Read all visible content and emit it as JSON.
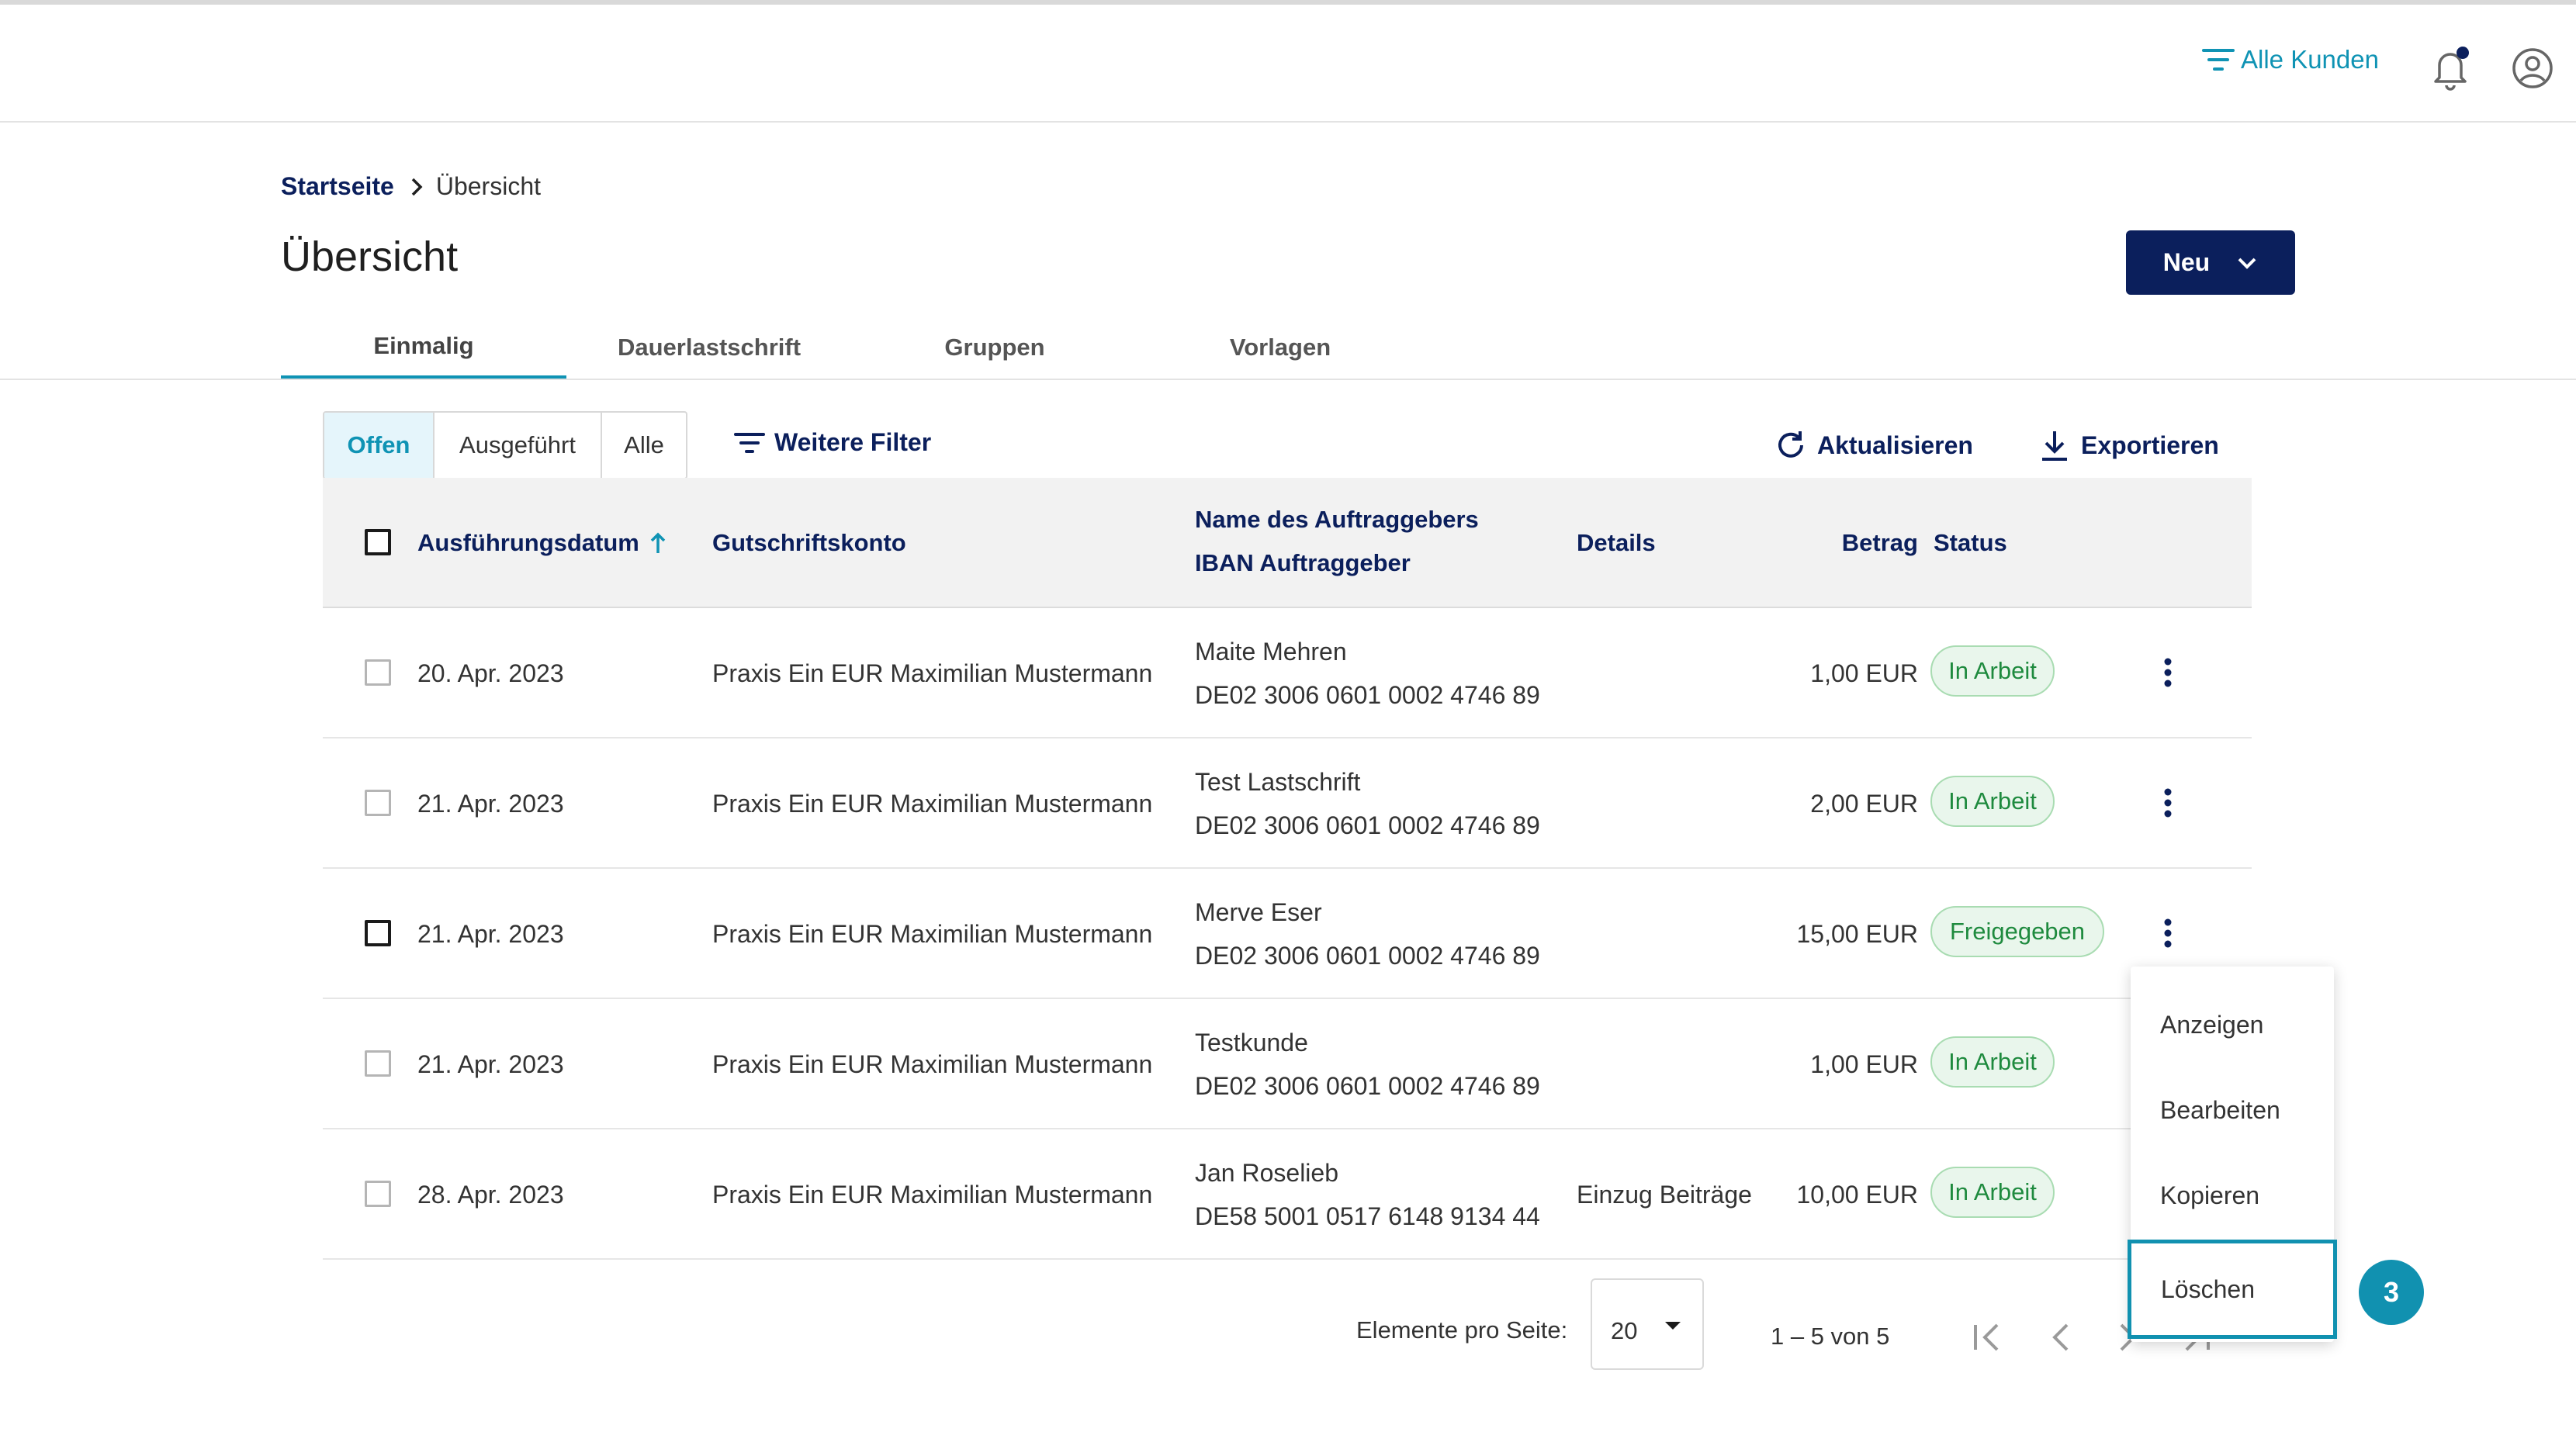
{
  "header": {
    "filter_label": "Alle Kunden"
  },
  "breadcrumb": {
    "home": "Startseite",
    "current": "Übersicht"
  },
  "page": {
    "title": "Übersicht",
    "new_button": "Neu"
  },
  "tabs": [
    {
      "label": "Einmalig",
      "active": true
    },
    {
      "label": "Dauerlastschrift",
      "active": false
    },
    {
      "label": "Gruppen",
      "active": false
    },
    {
      "label": "Vorlagen",
      "active": false
    }
  ],
  "filters": {
    "segments": [
      {
        "label": "Offen",
        "active": true
      },
      {
        "label": "Ausgeführt",
        "active": false
      },
      {
        "label": "Alle",
        "active": false
      }
    ],
    "more": "Weitere Filter",
    "refresh": "Aktualisieren",
    "export": "Exportieren"
  },
  "table": {
    "headers": {
      "date": "Ausführungsdatum",
      "account": "Gutschriftskonto",
      "name": "Name des Auftraggebers",
      "iban": "IBAN Auftraggeber",
      "details": "Details",
      "amount": "Betrag",
      "status": "Status"
    },
    "rows": [
      {
        "date": "20. Apr. 2023",
        "account": "Praxis Ein EUR Maximilian Mustermann",
        "name": "Maite Mehren",
        "iban": "DE02 3006 0601 0002 4746 89",
        "details": "",
        "amount": "1,00 EUR",
        "status": "In Arbeit"
      },
      {
        "date": "21. Apr. 2023",
        "account": "Praxis Ein EUR Maximilian Mustermann",
        "name": "Test Lastschrift",
        "iban": "DE02 3006 0601 0002 4746 89",
        "details": "",
        "amount": "2,00 EUR",
        "status": "In Arbeit"
      },
      {
        "date": "21. Apr. 2023",
        "account": "Praxis Ein EUR Maximilian Mustermann",
        "name": "Merve Eser",
        "iban": "DE02 3006 0601 0002 4746 89",
        "details": "",
        "amount": "15,00 EUR",
        "status": "Freigegeben"
      },
      {
        "date": "21. Apr. 2023",
        "account": "Praxis Ein EUR Maximilian Mustermann",
        "name": "Testkunde",
        "iban": "DE02 3006 0601 0002 4746 89",
        "details": "",
        "amount": "1,00 EUR",
        "status": "In Arbeit"
      },
      {
        "date": "28. Apr. 2023",
        "account": "Praxis Ein EUR Maximilian Mustermann",
        "name": "Jan Roselieb",
        "iban": "DE58 5001 0517 6148 9134 44",
        "details": "Einzug Beiträge",
        "amount": "10,00 EUR",
        "status": "In Arbeit"
      }
    ]
  },
  "pagination": {
    "label": "Elemente pro Seite:",
    "per_page": "20",
    "range": "1 – 5 von 5"
  },
  "context_menu": {
    "items": [
      "Anzeigen",
      "Bearbeiten",
      "Kopieren",
      "Löschen"
    ]
  },
  "step_badge": "3",
  "colors": {
    "primary": "#0b1f5c",
    "accent": "#0f93b4",
    "status_green": "#1e8a3e"
  }
}
